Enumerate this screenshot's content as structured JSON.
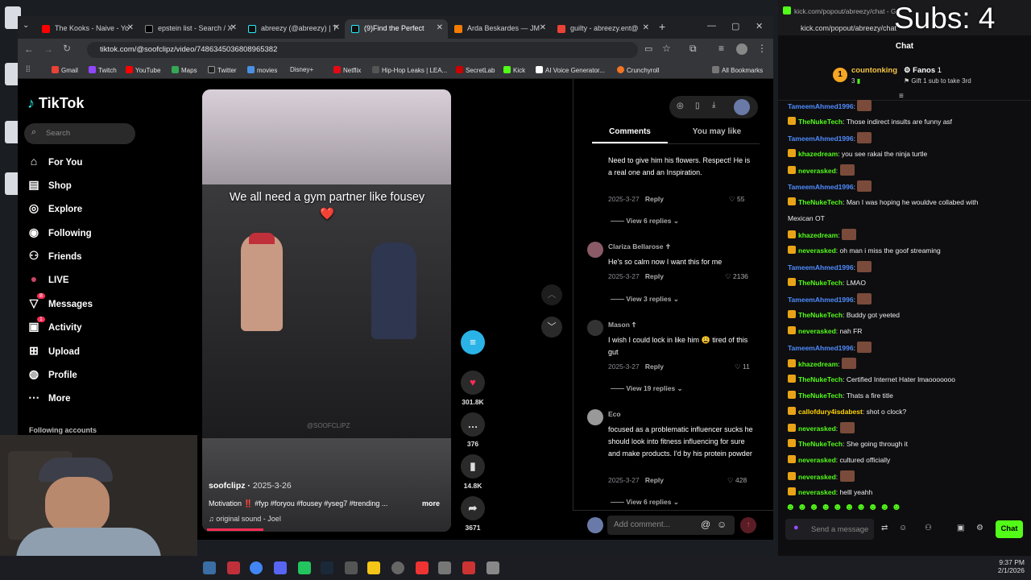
{
  "browser": {
    "tabs": [
      {
        "title": "The Kooks - Naive - Yo",
        "color": "#ff0000"
      },
      {
        "title": "epstein list - Search / X",
        "color": "#000000"
      },
      {
        "title": "abreezy (@abreezy) | T",
        "color": "#000000"
      },
      {
        "title": "(9)Find the Perfect",
        "color": "#000000"
      },
      {
        "title": "Arda Beskardes — JM",
        "color": "#f57c00"
      },
      {
        "title": "guilty - abreezy.ent@",
        "color": "#ea4335"
      }
    ],
    "new_tab": "+",
    "url": "tiktok.com/@soofclipz/video/7486345036808965382",
    "bookmarks": [
      "Gmail",
      "Twitch",
      "YouTube",
      "Maps",
      "Twitter",
      "movies",
      "Disney+",
      "Netflix",
      "Hip-Hop Leaks | LEA...",
      "SecretLab",
      "Kick",
      "AI Voice Generator...",
      "Crunchyroll"
    ],
    "all_bookmarks": "All Bookmarks"
  },
  "tiktok": {
    "logo": "TikTok",
    "search_placeholder": "Search",
    "nav": [
      {
        "label": "For You",
        "icon": "home-icon"
      },
      {
        "label": "Shop",
        "icon": "shop-icon"
      },
      {
        "label": "Explore",
        "icon": "compass-icon"
      },
      {
        "label": "Following",
        "icon": "following-icon"
      },
      {
        "label": "Friends",
        "icon": "friends-icon"
      },
      {
        "label": "LIVE",
        "icon": "live-icon"
      },
      {
        "label": "Messages",
        "icon": "messages-icon"
      },
      {
        "label": "Activity",
        "icon": "activity-icon"
      },
      {
        "label": "Upload",
        "icon": "upload-icon"
      },
      {
        "label": "Profile",
        "icon": "profile-icon"
      },
      {
        "label": "More",
        "icon": "more-icon"
      }
    ],
    "messages_badge": "8",
    "activity_badge": "1",
    "following_accounts": "Following accounts",
    "video": {
      "caption": "We all need a gym partner like fousey ❤️",
      "watermark": "@SOOFCLIPZ",
      "author": "soofclipz",
      "date": "2025-3-26",
      "description": "Motivation ‼️ #fyp #foryou #fousey #yseg7 #trending ...",
      "more": "more",
      "sound": "original sound - Joel"
    },
    "actions": {
      "likes": "301.8K",
      "comments": "376",
      "saves": "14.8K",
      "shares": "3671"
    },
    "tabs": {
      "comments": "Comments",
      "you_may_like": "You may like"
    },
    "comments": [
      {
        "user": "",
        "text": "Need to give him his flowers. Respect! He is a real one and an Inspiration.",
        "date": "2025-3-27",
        "reply": "Reply",
        "likes": "55",
        "replies": "View 6 replies"
      },
      {
        "user": "Clariza Bellarose ✝",
        "text": "He's so calm now I want this for me",
        "date": "2025-3-27",
        "reply": "Reply",
        "likes": "2136",
        "replies": "View 3 replies"
      },
      {
        "user": "Mason ☦",
        "text": "I wish I could lock in like him 😩 tired of this gut",
        "date": "2025-3-27",
        "reply": "Reply",
        "likes": "11",
        "replies": "View 19 replies"
      },
      {
        "user": "Eco",
        "text": "focused as a problematic influencer sucks he should look into fitness influencing for sure and make products. I'd by his protein powder",
        "date": "2025-3-27",
        "reply": "Reply",
        "likes": "428",
        "replies": "View 6 replies"
      }
    ],
    "add_comment": "Add comment..."
  },
  "chat": {
    "window_url": "kick.com/popout/abreezy/chat",
    "window_title": "kick.com/popout/abreezy/chat - Go",
    "subs_overlay": "Subs: 4",
    "header": "Chat",
    "top_user": "countonking",
    "top_user_count": "3",
    "fanos": "Fanos",
    "fanos_count": "1",
    "gift_text": "Gift 1 sub to take 3rd",
    "messages": [
      {
        "user": "TameemAhmed1996",
        "text": "",
        "color": "b",
        "emote": true
      },
      {
        "user": "TheNukeTech",
        "text": "Those indirect insults are funny asf",
        "color": "g"
      },
      {
        "user": "TameemAhmed1996",
        "text": "",
        "color": "b",
        "emote": true
      },
      {
        "user": "khazedream",
        "text": "you see rakai the ninja turtle",
        "color": "g"
      },
      {
        "user": "neverasked",
        "text": "",
        "color": "g",
        "emote": true
      },
      {
        "user": "TameemAhmed1996",
        "text": "",
        "color": "b",
        "emote": true
      },
      {
        "user": "TheNukeTech",
        "text": "Man I was hoping he wouldve collabed with",
        "color": "g"
      },
      {
        "user": "",
        "text": "Mexican OT",
        "color": "w"
      },
      {
        "user": "khazedream",
        "text": "",
        "color": "g",
        "emote": true
      },
      {
        "user": "neverasked",
        "text": "oh man i miss the goof streaming",
        "color": "g"
      },
      {
        "user": "TameemAhmed1996",
        "text": "",
        "color": "b",
        "emote": true
      },
      {
        "user": "TheNukeTech",
        "text": "LMAO",
        "color": "g"
      },
      {
        "user": "TameemAhmed1996",
        "text": "",
        "color": "b",
        "emote": true
      },
      {
        "user": "TheNukeTech",
        "text": "Buddy got yeeted",
        "color": "g"
      },
      {
        "user": "neverasked",
        "text": "nah FR",
        "color": "g"
      },
      {
        "user": "TameemAhmed1996",
        "text": "",
        "color": "b",
        "emote": true
      },
      {
        "user": "khazedream",
        "text": "",
        "color": "g",
        "emote": true
      },
      {
        "user": "TheNukeTech",
        "text": "Certified Internet Hater lmaooooooo",
        "color": "g"
      },
      {
        "user": "TheNukeTech",
        "text": "Thats a fire title",
        "color": "g"
      },
      {
        "user": "callofdury4isdabest",
        "text": "shot o clock?",
        "color": "y"
      },
      {
        "user": "neverasked",
        "text": "",
        "color": "g",
        "emote": true
      },
      {
        "user": "TheNukeTech",
        "text": "She going through it",
        "color": "g"
      },
      {
        "user": "neverasked",
        "text": "cultured officially",
        "color": "g"
      },
      {
        "user": "neverasked",
        "text": "",
        "color": "g",
        "emote": true
      },
      {
        "user": "neverasked",
        "text": "helll yeahh",
        "color": "g"
      }
    ],
    "input_placeholder": "Send a message",
    "send_button": "Chat"
  },
  "taskbar": {
    "time": "9:37 PM",
    "date": "2/1/2026"
  }
}
